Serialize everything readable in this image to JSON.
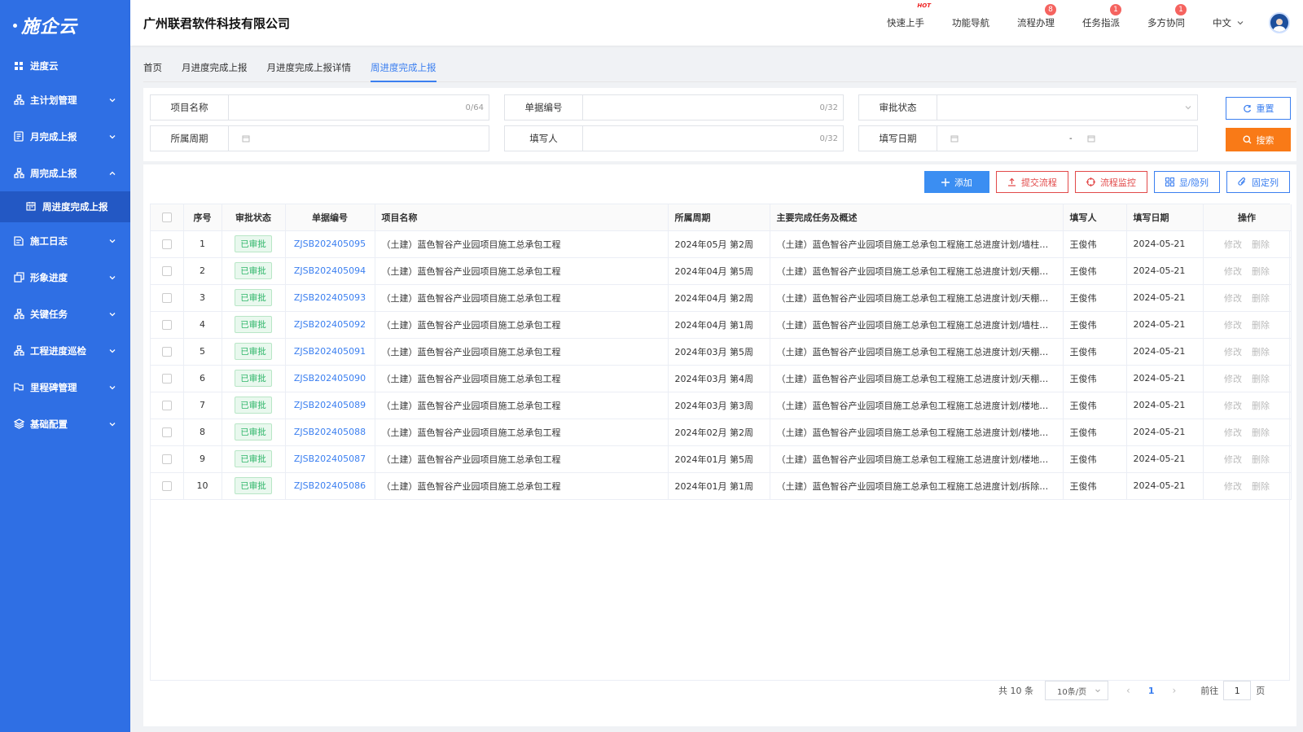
{
  "app": {
    "logo": "施企云"
  },
  "sidebar": {
    "items": [
      {
        "label": "进度云",
        "icon": "grid-icon"
      },
      {
        "label": "主计划管理",
        "icon": "org-chart-icon"
      },
      {
        "label": "月完成上报",
        "icon": "document-icon"
      },
      {
        "label": "周完成上报",
        "icon": "org-chart-icon",
        "expanded": true
      },
      {
        "label": "施工日志",
        "icon": "log-icon"
      },
      {
        "label": "形象进度",
        "icon": "stack-icon"
      },
      {
        "label": "关键任务",
        "icon": "org-chart-icon"
      },
      {
        "label": "工程进度巡检",
        "icon": "org-chart-icon"
      },
      {
        "label": "里程碑管理",
        "icon": "milestone-icon"
      },
      {
        "label": "基础配置",
        "icon": "layers-icon"
      }
    ],
    "sub_item": {
      "label": "周进度完成上报",
      "icon": "calendar-icon"
    }
  },
  "header": {
    "company": "广州联君软件科技有限公司",
    "nav": [
      {
        "label": "快速上手",
        "badge": "HOT"
      },
      {
        "label": "功能导航",
        "badge": ""
      },
      {
        "label": "流程办理",
        "badge": "8"
      },
      {
        "label": "任务指派",
        "badge": "1"
      },
      {
        "label": "多方协同",
        "badge": "1"
      }
    ],
    "language": "中文"
  },
  "tabs": [
    "首页",
    "月进度完成上报",
    "月进度完成上报详情",
    "周进度完成上报"
  ],
  "active_tab": 3,
  "filters": {
    "project_name": {
      "label": "项目名称",
      "counter": "0/64"
    },
    "doc_no": {
      "label": "单据编号",
      "counter": "0/32"
    },
    "approval_status": {
      "label": "审批状态"
    },
    "period": {
      "label": "所属周期"
    },
    "filler": {
      "label": "填写人",
      "counter": "0/32"
    },
    "fill_date": {
      "label": "填写日期",
      "separator": "-"
    },
    "reset_label": "重置",
    "search_label": "搜索"
  },
  "toolbar": {
    "add": "添加",
    "submit_flow": "提交流程",
    "flow_monitor": "流程监控",
    "show_hide": "显/隐列",
    "fix_column": "固定列"
  },
  "table": {
    "headers": [
      "序号",
      "审批状态",
      "单据编号",
      "项目名称",
      "所属周期",
      "主要完成任务及概述",
      "填写人",
      "填写日期",
      "操作"
    ],
    "rows": [
      {
        "no": "1",
        "status": "已审批",
        "doc": "ZJSB202405095",
        "project": "（土建）蓝色智谷产业园项目施工总承包工程",
        "period": "2024年05月 第2周",
        "summary": "（土建）蓝色智谷产业园项目施工总承包工程施工总进度计划/墙柱面...",
        "filler": "王俊伟",
        "date": "2024-05-21",
        "edit": "修改",
        "delete": "删除"
      },
      {
        "no": "2",
        "status": "已审批",
        "doc": "ZJSB202405094",
        "project": "（土建）蓝色智谷产业园项目施工总承包工程",
        "period": "2024年04月 第5周",
        "summary": "（土建）蓝色智谷产业园项目施工总承包工程施工总进度计划/天棚工...",
        "filler": "王俊伟",
        "date": "2024-05-21",
        "edit": "修改",
        "delete": "删除"
      },
      {
        "no": "3",
        "status": "已审批",
        "doc": "ZJSB202405093",
        "project": "（土建）蓝色智谷产业园项目施工总承包工程",
        "period": "2024年04月 第2周",
        "summary": "（土建）蓝色智谷产业园项目施工总承包工程施工总进度计划/天棚工...",
        "filler": "王俊伟",
        "date": "2024-05-21",
        "edit": "修改",
        "delete": "删除"
      },
      {
        "no": "4",
        "status": "已审批",
        "doc": "ZJSB202405092",
        "project": "（土建）蓝色智谷产业园项目施工总承包工程",
        "period": "2024年04月 第1周",
        "summary": "（土建）蓝色智谷产业园项目施工总承包工程施工总进度计划/墙柱面...",
        "filler": "王俊伟",
        "date": "2024-05-21",
        "edit": "修改",
        "delete": "删除"
      },
      {
        "no": "5",
        "status": "已审批",
        "doc": "ZJSB202405091",
        "project": "（土建）蓝色智谷产业园项目施工总承包工程",
        "period": "2024年03月 第5周",
        "summary": "（土建）蓝色智谷产业园项目施工总承包工程施工总进度计划/天棚工...",
        "filler": "王俊伟",
        "date": "2024-05-21",
        "edit": "修改",
        "delete": "删除"
      },
      {
        "no": "6",
        "status": "已审批",
        "doc": "ZJSB202405090",
        "project": "（土建）蓝色智谷产业园项目施工总承包工程",
        "period": "2024年03月 第4周",
        "summary": "（土建）蓝色智谷产业园项目施工总承包工程施工总进度计划/天棚工...",
        "filler": "王俊伟",
        "date": "2024-05-21",
        "edit": "修改",
        "delete": "删除"
      },
      {
        "no": "7",
        "status": "已审批",
        "doc": "ZJSB202405089",
        "project": "（土建）蓝色智谷产业园项目施工总承包工程",
        "period": "2024年03月 第3周",
        "summary": "（土建）蓝色智谷产业园项目施工总承包工程施工总进度计划/楼地面...",
        "filler": "王俊伟",
        "date": "2024-05-21",
        "edit": "修改",
        "delete": "删除"
      },
      {
        "no": "8",
        "status": "已审批",
        "doc": "ZJSB202405088",
        "project": "（土建）蓝色智谷产业园项目施工总承包工程",
        "period": "2024年02月 第2周",
        "summary": "（土建）蓝色智谷产业园项目施工总承包工程施工总进度计划/楼地面...",
        "filler": "王俊伟",
        "date": "2024-05-21",
        "edit": "修改",
        "delete": "删除"
      },
      {
        "no": "9",
        "status": "已审批",
        "doc": "ZJSB202405087",
        "project": "（土建）蓝色智谷产业园项目施工总承包工程",
        "period": "2024年01月 第5周",
        "summary": "（土建）蓝色智谷产业园项目施工总承包工程施工总进度计划/楼地面...",
        "filler": "王俊伟",
        "date": "2024-05-21",
        "edit": "修改",
        "delete": "删除"
      },
      {
        "no": "10",
        "status": "已审批",
        "doc": "ZJSB202405086",
        "project": "（土建）蓝色智谷产业园项目施工总承包工程",
        "period": "2024年01月 第1周",
        "summary": "（土建）蓝色智谷产业园项目施工总承包工程施工总进度计划/拆除工...",
        "filler": "王俊伟",
        "date": "2024-05-21",
        "edit": "修改",
        "delete": "删除"
      }
    ]
  },
  "pagination": {
    "total": "共 10 条",
    "page_size": "10条/页",
    "current": "1",
    "goto_prefix": "前往",
    "goto_value": "1",
    "goto_suffix": "页"
  },
  "colors": {
    "sidebar": "#2f6fe4",
    "primary": "#3b7ff0",
    "search": "#f97a17",
    "danger": "#e24a4a",
    "approved": "#2fb66a"
  }
}
